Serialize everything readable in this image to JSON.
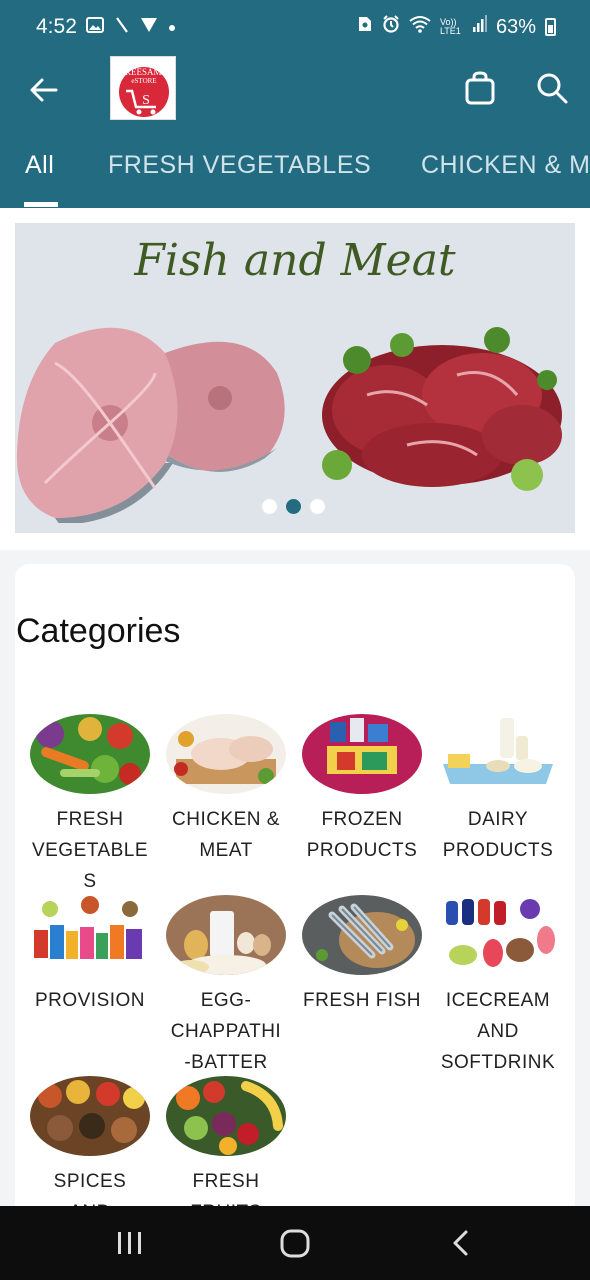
{
  "status_bar": {
    "time": "4:52",
    "network_label": "Vo)) LTE1",
    "battery": "63%",
    "left_icons": [
      "image-icon",
      "slash-icon",
      "filter-icon",
      "dot-icon"
    ],
    "right_icons": [
      "sim-icon",
      "alarm-icon",
      "wifi-icon",
      "signal-icon",
      "battery-icon"
    ]
  },
  "app_bar": {
    "logo_text": [
      "SREESAMA",
      "eSTORE"
    ],
    "tabs": [
      {
        "label": "All",
        "selected": true
      },
      {
        "label": "FRESH VEGETABLES",
        "selected": false
      },
      {
        "label": "CHICKEN & M",
        "selected": false
      }
    ]
  },
  "banner": {
    "title": "Fish and Meat",
    "slide_count": 3,
    "active_slide": 2
  },
  "categories": {
    "title": "Categories",
    "items": [
      {
        "label": [
          "FRESH",
          "VEGETABLE",
          "S"
        ],
        "icon": "vegetables-icon"
      },
      {
        "label": [
          "CHICKEN &",
          "MEAT"
        ],
        "icon": "chicken-icon"
      },
      {
        "label": [
          "FROZEN",
          "PRODUCTS"
        ],
        "icon": "frozen-products-icon"
      },
      {
        "label": [
          "DAIRY",
          "PRODUCTS"
        ],
        "icon": "dairy-icon"
      },
      {
        "label": [
          "PROVISION"
        ],
        "icon": "provision-icon"
      },
      {
        "label": [
          "EGG-",
          "CHAPPATHI",
          "-BATTER"
        ],
        "icon": "egg-icon"
      },
      {
        "label": [
          "FRESH FISH"
        ],
        "icon": "fish-icon"
      },
      {
        "label": [
          "ICECREAM",
          "AND",
          "SOFTDRINK"
        ],
        "icon": "icecream-icon"
      },
      {
        "label": [
          "SPICES",
          "AND"
        ],
        "icon": "spices-icon"
      },
      {
        "label": [
          "FRESH",
          "FRUITS"
        ],
        "icon": "fruits-icon"
      }
    ]
  },
  "colors": {
    "primary": "#236b80",
    "banner_title": "#3f5a23",
    "logo_red": "#d8283a"
  },
  "nav_bar": {
    "buttons": [
      "recents-icon",
      "home-icon",
      "back-icon"
    ]
  }
}
